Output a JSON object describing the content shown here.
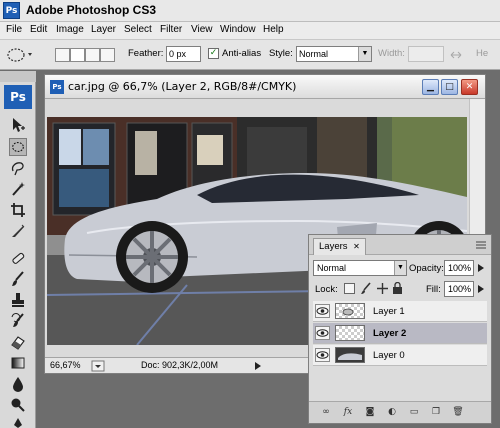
{
  "app": {
    "title": "Adobe Photoshop CS3",
    "icon_text": "Ps"
  },
  "menu": [
    "File",
    "Edit",
    "Image",
    "Layer",
    "Select",
    "Filter",
    "View",
    "Window",
    "Help"
  ],
  "options_bar": {
    "feather_label": "Feather:",
    "feather_value": "0 px",
    "antialias_label": "Anti-alias",
    "antialias_checked": true,
    "style_label": "Style:",
    "style_value": "Normal",
    "width_label": "Width:",
    "height_label": "He"
  },
  "toolbox": {
    "logo": "Ps",
    "tools": [
      "move-tool",
      "marquee-tool",
      "lasso-tool",
      "magic-wand-tool",
      "crop-tool",
      "slice-tool",
      "healing-brush-tool",
      "brush-tool",
      "clone-stamp-tool",
      "history-brush-tool",
      "eraser-tool",
      "gradient-tool",
      "blur-tool",
      "dodge-tool",
      "pen-tool",
      "type-tool"
    ]
  },
  "document": {
    "title": "car.jpg @ 66,7% (Layer 2, RGB/8#/CMYK)",
    "zoom": "66,67%",
    "doc_size": "Doc: 902,3K/2,00M"
  },
  "layers_panel": {
    "tab": "Layers",
    "blend_mode": "Normal",
    "opacity_label": "Opacity:",
    "opacity_value": "100%",
    "lock_label": "Lock:",
    "fill_label": "Fill:",
    "fill_value": "100%",
    "layers": [
      {
        "name": "Layer 1",
        "selected": false
      },
      {
        "name": "Layer 2",
        "selected": true
      },
      {
        "name": "Layer 0",
        "selected": false
      }
    ]
  },
  "colors": {
    "app_blue": "#1f5fb5",
    "close_red": "#c8392a",
    "selected_layer": "#b9b9c4"
  }
}
